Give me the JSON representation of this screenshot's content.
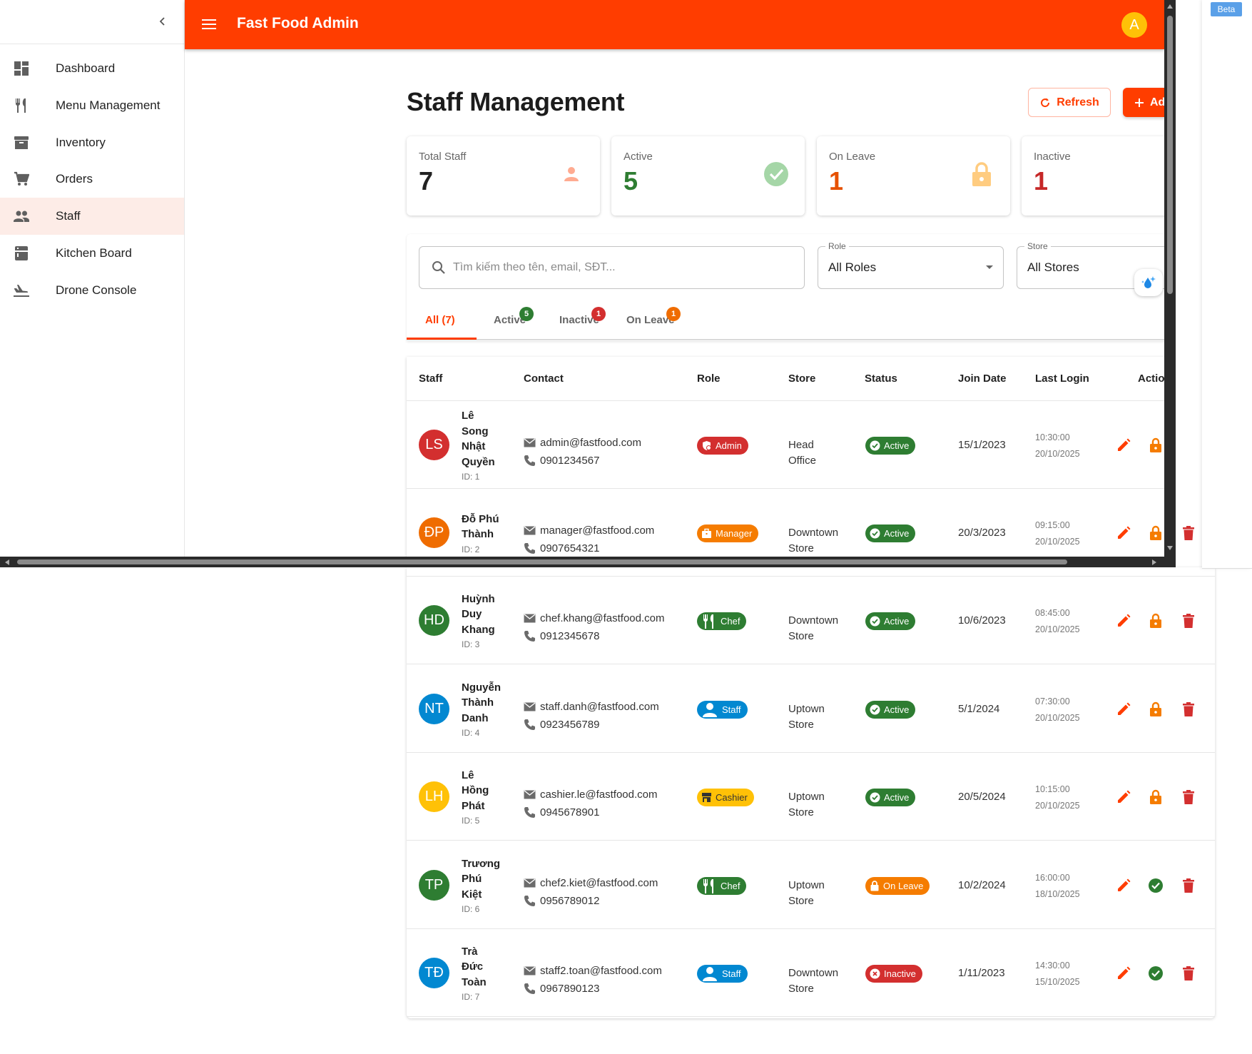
{
  "sidebar": {
    "items": [
      {
        "label": "Dashboard",
        "icon": "dashboard-icon"
      },
      {
        "label": "Menu Management",
        "icon": "utensils-icon"
      },
      {
        "label": "Inventory",
        "icon": "archive-icon"
      },
      {
        "label": "Orders",
        "icon": "cart-icon"
      },
      {
        "label": "Staff",
        "icon": "people-icon",
        "active": true
      },
      {
        "label": "Kitchen Board",
        "icon": "kitchen-icon"
      },
      {
        "label": "Drone Console",
        "icon": "plane-icon"
      }
    ]
  },
  "topbar": {
    "title": "Fast Food Admin",
    "avatar": "A",
    "color": "#ff3d00"
  },
  "page": {
    "title": "Staff Management",
    "refresh_label": "Refresh",
    "add_label": "Add Staff"
  },
  "stats": [
    {
      "label": "Total Staff",
      "value": "7",
      "color": "#222222"
    },
    {
      "label": "Active",
      "value": "5",
      "color": "#2e7d32"
    },
    {
      "label": "On Leave",
      "value": "1",
      "color": "#e65100"
    },
    {
      "label": "Inactive",
      "value": "1",
      "color": "#c62828"
    }
  ],
  "filters": {
    "search_placeholder": "Tìm kiếm theo tên, email, SĐT...",
    "role_legend": "Role",
    "role_value": "All Roles",
    "store_legend": "Store",
    "store_value": "All Stores"
  },
  "tabs": [
    {
      "label": "All (7)",
      "badge": ""
    },
    {
      "label": "Active",
      "badge": "5",
      "badge_color": "#2e7d32"
    },
    {
      "label": "Inactive",
      "badge": "1",
      "badge_color": "#d32f2f"
    },
    {
      "label": "On Leave",
      "badge": "1",
      "badge_color": "#ef6c00"
    }
  ],
  "table": {
    "headers": [
      "Staff",
      "Contact",
      "Role",
      "Store",
      "Status",
      "Join Date",
      "Last Login",
      "Actions"
    ],
    "rows": [
      {
        "initials": "LS",
        "avatar_color": "#d32f2f",
        "name": [
          "Lê",
          "Song",
          "Nhật",
          "Quyền"
        ],
        "id": "ID: 1",
        "email": "admin@fastfood.com",
        "phone": "0901234567",
        "role": "Admin",
        "role_color": "#d32f2f",
        "role_icon": "admin-icon",
        "store": [
          "Head",
          "Office"
        ],
        "status": "Active",
        "status_color": "#2e7d32",
        "join": "15/1/2023",
        "login_time": "10:30:00",
        "login_date": "20/10/2025",
        "toggle": "lock"
      },
      {
        "initials": "ĐP",
        "avatar_color": "#ef6c00",
        "name": [
          "Đỗ Phú",
          "Thành"
        ],
        "id": "ID: 2",
        "email": "manager@fastfood.com",
        "phone": "0907654321",
        "role": "Manager",
        "role_color": "#f57c00",
        "role_icon": "briefcase-icon",
        "store": [
          "Downtown",
          "Store"
        ],
        "status": "Active",
        "status_color": "#2e7d32",
        "join": "20/3/2023",
        "login_time": "09:15:00",
        "login_date": "20/10/2025",
        "toggle": "lock"
      },
      {
        "initials": "HD",
        "avatar_color": "#2e7d32",
        "name": [
          "Huỳnh",
          "Duy",
          "Khang"
        ],
        "id": "ID: 3",
        "email": "chef.khang@fastfood.com",
        "phone": "0912345678",
        "role": "Chef",
        "role_color": "#2e7d32",
        "role_icon": "utensils-icon",
        "store": [
          "Downtown",
          "Store"
        ],
        "status": "Active",
        "status_color": "#2e7d32",
        "join": "10/6/2023",
        "login_time": "08:45:00",
        "login_date": "20/10/2025",
        "toggle": "lock"
      },
      {
        "initials": "NT",
        "avatar_color": "#0288d1",
        "name": [
          "Nguyễn",
          "Thành",
          "Danh"
        ],
        "id": "ID: 4",
        "email": "staff.danh@fastfood.com",
        "phone": "0923456789",
        "role": "Staff",
        "role_color": "#0288d1",
        "role_icon": "person-icon",
        "store": [
          "Uptown",
          "Store"
        ],
        "status": "Active",
        "status_color": "#2e7d32",
        "join": "5/1/2024",
        "login_time": "07:30:00",
        "login_date": "20/10/2025",
        "toggle": "lock"
      },
      {
        "initials": "LH",
        "avatar_color": "#ffc107",
        "name": [
          "Lê",
          "Hồng",
          "Phát"
        ],
        "id": "ID: 5",
        "email": "cashier.le@fastfood.com",
        "phone": "0945678901",
        "role": "Cashier",
        "role_color": "#ffc107",
        "role_icon": "store-icon",
        "store": [
          "Uptown",
          "Store"
        ],
        "status": "Active",
        "status_color": "#2e7d32",
        "join": "20/5/2024",
        "login_time": "10:15:00",
        "login_date": "20/10/2025",
        "toggle": "lock"
      },
      {
        "initials": "TP",
        "avatar_color": "#2e7d32",
        "name": [
          "Trương",
          "Phú",
          "Kiệt"
        ],
        "id": "ID: 6",
        "email": "chef2.kiet@fastfood.com",
        "phone": "0956789012",
        "role": "Chef",
        "role_color": "#2e7d32",
        "role_icon": "utensils-icon",
        "store": [
          "Uptown",
          "Store"
        ],
        "status": "On Leave",
        "status_color": "#f57c00",
        "join": "10/2/2024",
        "login_time": "16:00:00",
        "login_date": "18/10/2025",
        "toggle": "check"
      },
      {
        "initials": "TĐ",
        "avatar_color": "#0288d1",
        "name": [
          "Trà",
          "Đức",
          "Toàn"
        ],
        "id": "ID: 7",
        "email": "staff2.toan@fastfood.com",
        "phone": "0967890123",
        "role": "Staff",
        "role_color": "#0288d1",
        "role_icon": "person-icon",
        "store": [
          "Downtown",
          "Store"
        ],
        "status": "Inactive",
        "status_color": "#d32f2f",
        "join": "1/11/2023",
        "login_time": "14:30:00",
        "login_date": "15/10/2025",
        "toggle": "check"
      }
    ]
  },
  "extras": {
    "beta_label": "Beta"
  }
}
